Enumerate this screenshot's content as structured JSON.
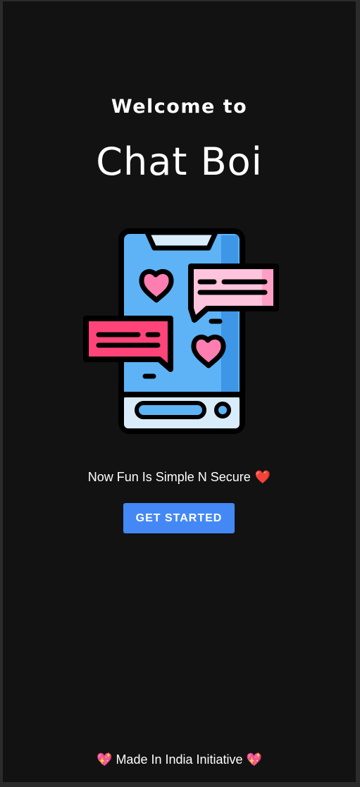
{
  "welcome": {
    "line1": "Welcome to",
    "app_name": "Chat Boi"
  },
  "illustration": {
    "icon": "phone-chat-hearts-icon"
  },
  "tagline": {
    "text": "Now Fun Is Simple N Secure",
    "emoji": "❤️"
  },
  "cta": {
    "label": "GET STARTED"
  },
  "footer": {
    "emoji_left": "💖",
    "text": "Made In India Initiative",
    "emoji_right": "💖"
  },
  "colors": {
    "background": "#121212",
    "button": "#4488f6",
    "text": "#ffffff"
  }
}
